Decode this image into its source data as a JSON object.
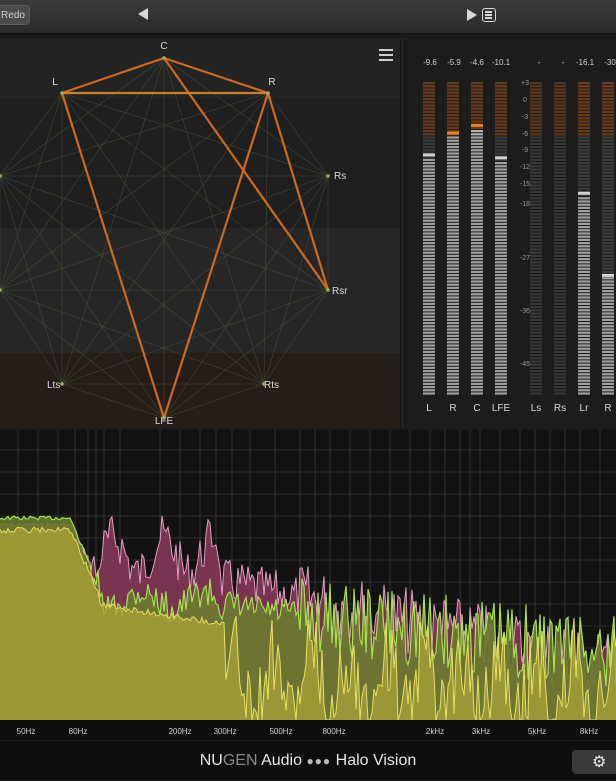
{
  "toolbar": {
    "redo_label": "Redo",
    "back_icon": "triangle-left-icon",
    "play_icon": "triangle-right-icon",
    "preset_icon": "list-icon"
  },
  "scope": {
    "menu_icon": "hamburger-icon",
    "channels": [
      "C",
      "R",
      "Rs",
      "Rsr",
      "Rts",
      "LFE",
      "Lts",
      "L"
    ],
    "highlight_color": "#e07020",
    "web_color": "#4a5a3a"
  },
  "meters": {
    "peak_values": [
      "-9.6",
      "-5.9",
      "-4.6",
      "-10.1",
      "-",
      "-",
      "-16.1",
      "-30"
    ],
    "scale_labels": [
      "+3",
      "0",
      "-3",
      "-6",
      "-9",
      "-12",
      "-15",
      "-18",
      "-27",
      "-36",
      "-45"
    ],
    "channel_labels": [
      "L",
      "R",
      "C",
      "LFE",
      "Ls",
      "Rs",
      "Lr",
      "R"
    ]
  },
  "spectrum": {
    "freq_labels": [
      "50Hz",
      "80Hz",
      "200Hz",
      "300Hz",
      "500Hz",
      "800Hz",
      "2kHz",
      "3kHz",
      "5kHz",
      "8kHz"
    ],
    "colors": {
      "pink": "#c0507a",
      "green": "#8ab83a",
      "yellow": "#c8c040"
    }
  },
  "footer": {
    "brand_nu": "NU",
    "brand_gen": "GEN",
    "brand_audio": " Audio ",
    "brand_dots": "●●●",
    "brand_product": " Halo Vision",
    "settings_icon": "gear-icon"
  }
}
